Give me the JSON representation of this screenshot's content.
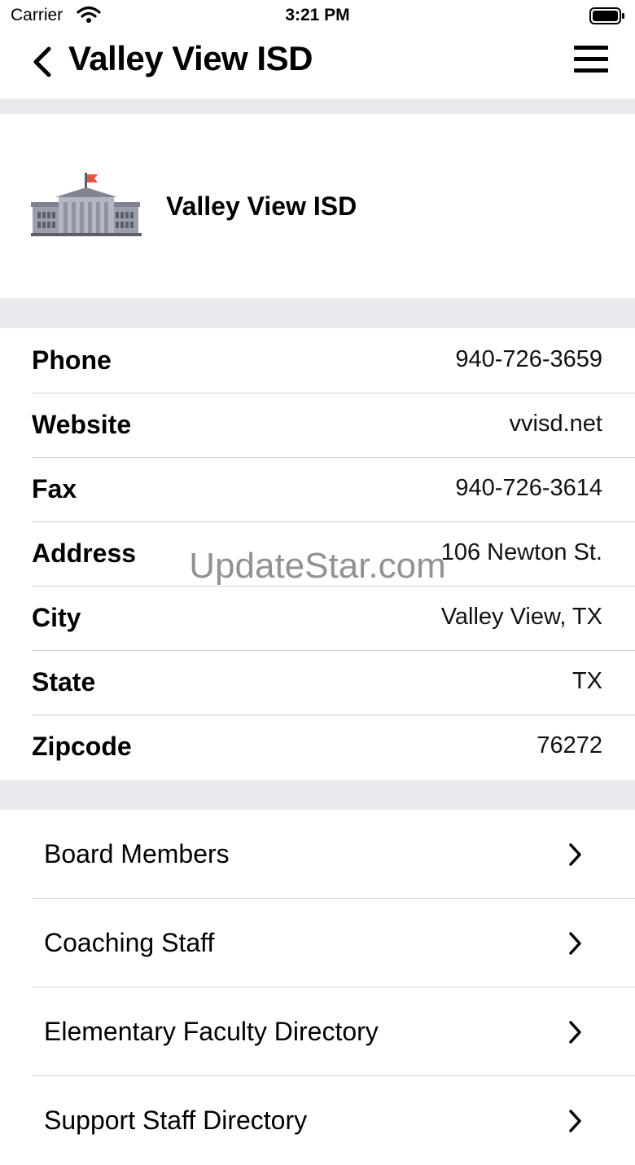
{
  "status_bar": {
    "carrier": "Carrier",
    "time": "3:21 PM"
  },
  "nav": {
    "title": "Valley View ISD"
  },
  "header": {
    "name": "Valley View ISD"
  },
  "info": [
    {
      "label": "Phone",
      "value": "940-726-3659"
    },
    {
      "label": "Website",
      "value": "vvisd.net"
    },
    {
      "label": "Fax",
      "value": "940-726-3614"
    },
    {
      "label": "Address",
      "value": "106 Newton St."
    },
    {
      "label": "City",
      "value": "Valley View, TX"
    },
    {
      "label": "State",
      "value": "TX"
    },
    {
      "label": "Zipcode",
      "value": "76272"
    }
  ],
  "links": [
    {
      "label": "Board Members"
    },
    {
      "label": "Coaching Staff"
    },
    {
      "label": "Elementary Faculty Directory"
    },
    {
      "label": "Support Staff Directory"
    }
  ],
  "watermark": "UpdateStar.com",
  "colors": {
    "separator": "#e9eaee",
    "flag": "#e8543a",
    "building": "#8f93a3"
  }
}
